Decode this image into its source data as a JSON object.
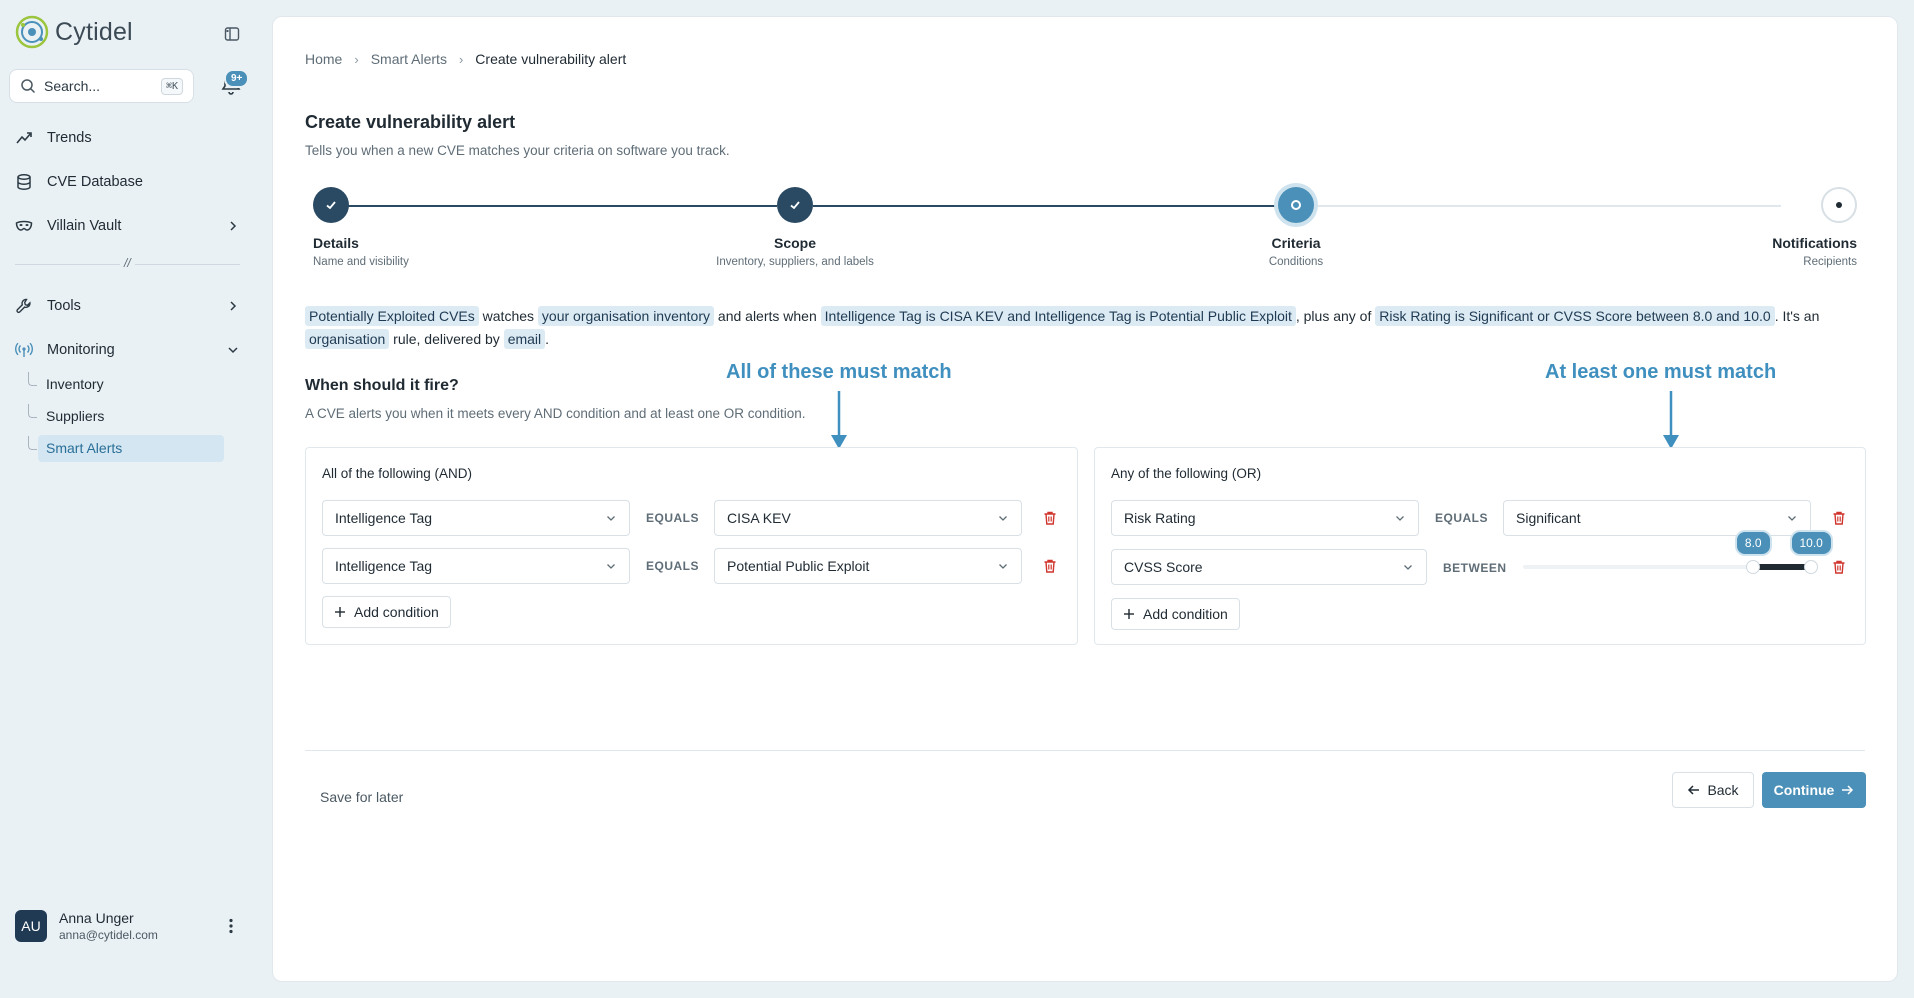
{
  "app": {
    "name": "Cytidel"
  },
  "search": {
    "placeholder": "Search...",
    "shortcut": "⌘K"
  },
  "notifications": {
    "badge": "9+"
  },
  "nav": {
    "trends": "Trends",
    "cve_database": "CVE Database",
    "villain_vault": "Villain Vault",
    "divider_mark": "//",
    "tools": "Tools",
    "monitoring": "Monitoring",
    "inventory": "Inventory",
    "suppliers": "Suppliers",
    "smart_alerts": "Smart Alerts"
  },
  "user": {
    "initials": "AU",
    "name": "Anna Unger",
    "email": "anna@cytidel.com"
  },
  "breadcrumb": {
    "home": "Home",
    "smart_alerts": "Smart Alerts",
    "current": "Create vulnerability alert"
  },
  "page": {
    "title": "Create vulnerability alert",
    "subtitle": "Tells you when a new CVE matches your criteria on software you track."
  },
  "steps": [
    {
      "label": "Details",
      "desc": "Name and visibility",
      "state": "done"
    },
    {
      "label": "Scope",
      "desc": "Inventory, suppliers, and labels",
      "state": "done"
    },
    {
      "label": "Criteria",
      "desc": "Conditions",
      "state": "current"
    },
    {
      "label": "Notifications",
      "desc": "Recipients",
      "state": "pending"
    }
  ],
  "summary": {
    "alert_name": "Potentially Exploited CVEs",
    "t1": "watches",
    "scope": "your organisation inventory",
    "t2": "and alerts when",
    "and_conditions": "Intelligence Tag is CISA KEV and Intelligence Tag is Potential Public Exploit",
    "t3": ", plus any of",
    "or_conditions": "Risk Rating is Significant or CVSS Score between 8.0 and 10.0",
    "t4": ". It's an",
    "visibility": "organisation",
    "t5": "rule, delivered by",
    "channel": "email",
    "t6": "."
  },
  "criteria": {
    "title": "When should it fire?",
    "subtitle": "A CVE alerts you when it meets every AND condition and at least one OR condition.",
    "annot_and": "All of these must match",
    "annot_or": "At least one must match",
    "and_group": {
      "title": "All of the following (AND)",
      "rows": [
        {
          "field": "Intelligence Tag",
          "op": "EQUALS",
          "value": "CISA KEV"
        },
        {
          "field": "Intelligence Tag",
          "op": "EQUALS",
          "value": "Potential Public Exploit"
        }
      ],
      "add_label": "Add condition"
    },
    "or_group": {
      "title": "Any of the following (OR)",
      "rows": [
        {
          "field": "Risk Rating",
          "op": "EQUALS",
          "value": "Significant"
        },
        {
          "field": "CVSS Score",
          "op": "BETWEEN",
          "min": "8.0",
          "max": "10.0",
          "range_min": 0,
          "range_max": 10
        }
      ],
      "add_label": "Add condition"
    }
  },
  "footer": {
    "save_later": "Save for later",
    "back": "Back",
    "continue": "Continue"
  },
  "colors": {
    "accent": "#4a90b8",
    "done": "#2a4a63",
    "danger": "#d0342c",
    "chip": "#dbeaf3"
  }
}
